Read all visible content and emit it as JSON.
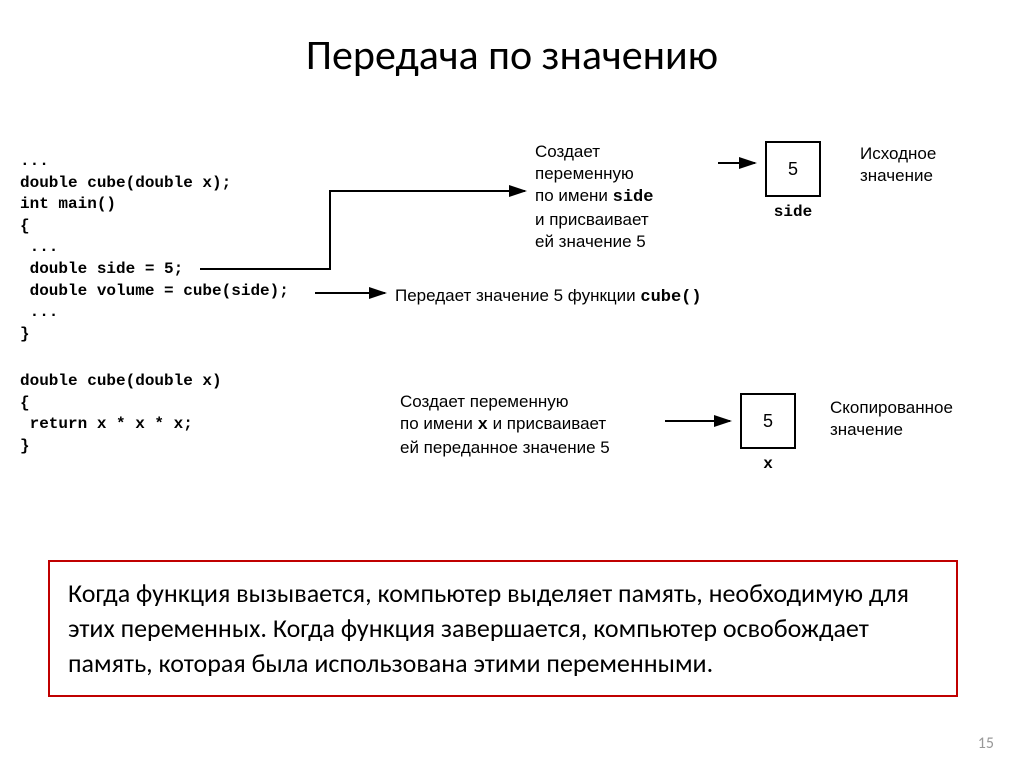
{
  "title": "Передача по значению",
  "code": {
    "block1": "...\ndouble cube(double x);\nint main()\n{\n ...\n double side = 5;\n double volume = cube(side);\n ...\n}",
    "block2": "double cube(double x)\n{\n return x * x * x;\n}"
  },
  "annot": {
    "a1_l1": "Создает",
    "a1_l2": "переменную",
    "a1_l3_pre": "по имени ",
    "a1_l3_mono": "side",
    "a1_l4": "и присваивает",
    "a1_l5": "ей значение 5",
    "a2_pre": "Передает значение 5 функции ",
    "a2_mono": "cube()",
    "a3_l1": "Создает переменную",
    "a3_l2_pre": "по имени ",
    "a3_l2_mono": "x",
    "a3_l2_post": " и присваивает",
    "a3_l3": "ей переданное значение 5"
  },
  "boxes": {
    "b1_val": "5",
    "b1_label": "side",
    "b1_note_l1": "Исходное",
    "b1_note_l2": "значение",
    "b2_val": "5",
    "b2_label": "x",
    "b2_note_l1": "Скопированное",
    "b2_note_l2": "значение"
  },
  "note": "Когда функция вызывается, компьютер выделяет память, необходимую для этих переменных. Когда функция завершается, компьютер освобождает память, которая была использована этими переменными.",
  "pagenum": "15"
}
